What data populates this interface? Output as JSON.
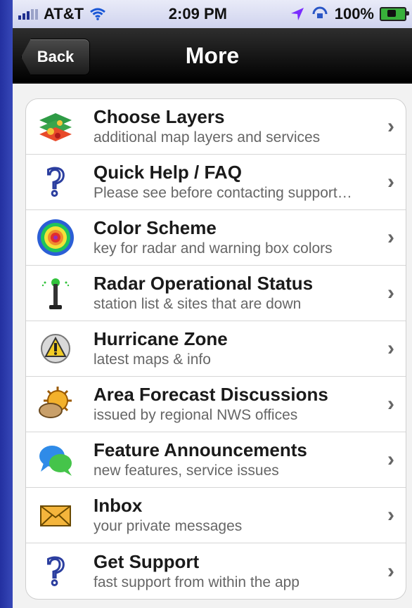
{
  "status_bar": {
    "carrier": "AT&T",
    "time": "2:09 PM",
    "battery": "100%",
    "icons": {
      "signal": "signal-bars-icon",
      "wifi": "wifi-icon",
      "location": "location-arrow-icon",
      "lock": "rotation-lock-icon",
      "battery": "battery-icon"
    }
  },
  "nav": {
    "back_label": "Back",
    "title": "More"
  },
  "menu": {
    "items": [
      {
        "title": "Choose Layers",
        "subtitle": "additional map layers and services",
        "icon": "layers-icon"
      },
      {
        "title": "Quick Help / FAQ",
        "subtitle": "Please see before contacting support…",
        "icon": "question-mark-icon"
      },
      {
        "title": "Color Scheme",
        "subtitle": "key for radar and warning box colors",
        "icon": "color-scheme-icon"
      },
      {
        "title": "Radar Operational Status",
        "subtitle": "station list & sites that are down",
        "icon": "radar-antenna-icon"
      },
      {
        "title": "Hurricane Zone",
        "subtitle": "latest maps & info",
        "icon": "warning-icon"
      },
      {
        "title": "Area Forecast Discussions",
        "subtitle": "issued by regional NWS offices",
        "icon": "sun-cloud-icon"
      },
      {
        "title": "Feature Announcements",
        "subtitle": "new features, service issues",
        "icon": "chat-bubbles-icon"
      },
      {
        "title": "Inbox",
        "subtitle": "your private messages",
        "icon": "envelope-icon"
      },
      {
        "title": "Get Support",
        "subtitle": "fast support from within the app",
        "icon": "question-mark-icon"
      }
    ],
    "chevron": "›"
  }
}
